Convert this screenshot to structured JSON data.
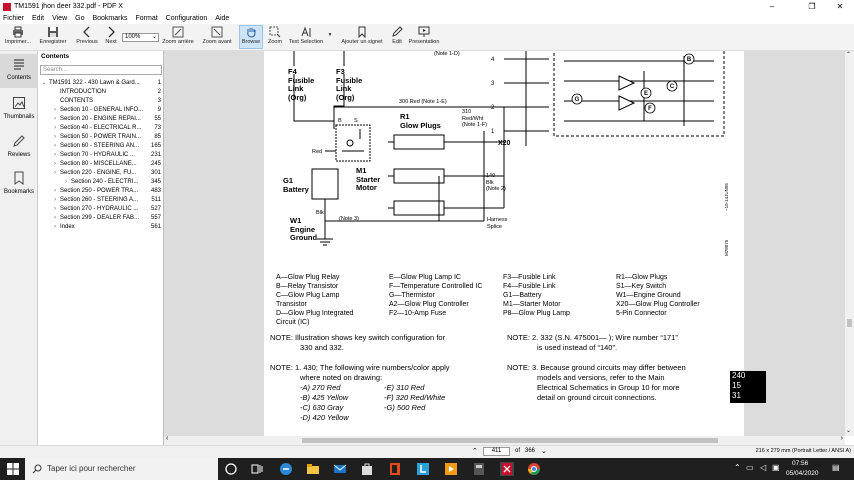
{
  "window": {
    "title": "TM1591 jhon deer 332.pdf - PDF X",
    "minimize": "–",
    "maximize": "❐",
    "close": "✕"
  },
  "menu": [
    "Fichier",
    "Edit",
    "View",
    "Go",
    "Bookmarks",
    "Format",
    "Configuration",
    "Aide"
  ],
  "toolbar": {
    "print": "Imprimer...",
    "save": "Enregistrer",
    "previous": "Previous",
    "next": "Next",
    "zoom_value": "100%",
    "zoom_back": "Zoom arrière",
    "zoom_forward": "Zoom avant",
    "browse": "Browse",
    "zoom": "Zoom",
    "text_selection": "Text Selection",
    "add_bookmark": "Ajouter un signet",
    "edit": "Edit",
    "presentation": "Presentation"
  },
  "left_rail": {
    "contents": "Contents",
    "thumbnails": "Thumbnails",
    "reviews": "Reviews",
    "bookmarks": "Bookmarks"
  },
  "nav_panel": {
    "title": "Contents",
    "search_placeholder": "Search...",
    "items": [
      {
        "label": "TM1591 322 - 430 Lawn & Gard...",
        "page": "1",
        "arrow": "⌄",
        "indent": 0
      },
      {
        "label": "INTRODUCTION",
        "page": "2",
        "arrow": "",
        "indent": 1
      },
      {
        "label": "CONTENTS",
        "page": "3",
        "arrow": "",
        "indent": 1
      },
      {
        "label": "Section 10 - GENERAL INFO...",
        "page": "9",
        "arrow": "›",
        "indent": 1
      },
      {
        "label": "Section 20 - ENGINE REPAI...",
        "page": "55",
        "arrow": "›",
        "indent": 1
      },
      {
        "label": "Section 40 - ELECTRICAL R...",
        "page": "73",
        "arrow": "›",
        "indent": 1
      },
      {
        "label": "Section 50 - POWER TRAIN...",
        "page": "85",
        "arrow": "›",
        "indent": 1
      },
      {
        "label": "Section 60 - STEERING AN...",
        "page": "165",
        "arrow": "›",
        "indent": 1
      },
      {
        "label": "Section 70 - HYDRAULIC ...",
        "page": "231",
        "arrow": "›",
        "indent": 1
      },
      {
        "label": "Section 80 - MISCELLANE...",
        "page": "245",
        "arrow": "›",
        "indent": 1
      },
      {
        "label": "Section 220 - ENGINE, FU...",
        "page": "301",
        "arrow": "›",
        "indent": 1
      },
      {
        "label": "Section 240 - ELECTRI...",
        "page": "345",
        "arrow": "›",
        "indent": 2
      },
      {
        "label": "Section 250 - POWER TRA...",
        "page": "483",
        "arrow": "›",
        "indent": 1
      },
      {
        "label": "Section 260 - STEERING A...",
        "page": "511",
        "arrow": "›",
        "indent": 1
      },
      {
        "label": "Section 270 - HYDRAULIC ...",
        "page": "527",
        "arrow": "›",
        "indent": 1
      },
      {
        "label": "Section 299 - DEALER FAB...",
        "page": "557",
        "arrow": "›",
        "indent": 1
      },
      {
        "label": "Index",
        "page": "561",
        "arrow": "›",
        "indent": 1
      }
    ]
  },
  "diagram": {
    "f4": [
      "F4",
      "Fusible",
      "Link",
      "(Org)"
    ],
    "f3": [
      "F3",
      "Fusible",
      "Link",
      "(Org)"
    ],
    "note1e": "300 Red (Note 1-E)",
    "note1d": "(Note 1-D)",
    "r1": [
      "R1",
      "Glow Plugs"
    ],
    "wire310": [
      "310",
      "Red/Wht",
      "(Note 1-F)"
    ],
    "red": "Red",
    "b": "B",
    "s": "S",
    "m1": [
      "M1",
      "Starter",
      "Motor"
    ],
    "g1": [
      "G1",
      "Battery"
    ],
    "blk": "Blk",
    "note3": "(Note 3)",
    "w1": [
      "W1",
      "Engine",
      "Ground"
    ],
    "wire140": [
      "140",
      "Blk",
      "(Note 2)"
    ],
    "harness": [
      "Harness",
      "Splice"
    ],
    "x20": "X20",
    "pins": [
      "4",
      "3",
      "2",
      "1"
    ],
    "circle_labels": [
      "B",
      "C",
      "E",
      "F",
      "G"
    ],
    "side_codes": [
      "~19-14JUN95",
      "M78075"
    ]
  },
  "legend": [
    [
      "A—Glow Plug Relay",
      "B—Relay Transistor",
      "C—Glow Plug Lamp",
      "   Transistor",
      "D—Glow Plug Integrated",
      "   Circuit (IC)"
    ],
    [
      "E—Glow Plug Lamp IC",
      "F—Temperature Controlled IC",
      "G—Thermistor",
      "A2—Glow Plug Controller",
      "F2—10-Amp Fuse"
    ],
    [
      "F3—Fusible Link",
      "F4—Fusible Link",
      "G1—Battery",
      "M1—Starter Motor",
      "P8—Glow Plug Lamp"
    ],
    [
      "R1—Glow Plugs",
      "S1—Key Switch",
      "W1—Engine Ground",
      "X20—Glow Plug Controller",
      "   5-Pin Connector"
    ]
  ],
  "notes": {
    "left1": [
      "NOTE: Illustration shows key switch configuration for",
      "330 and 332."
    ],
    "left2_head": "NOTE: 1. 430; The following wire numbers/color apply",
    "left2_sub": "where noted on drawing:",
    "left2_colA": [
      "-A) 270 Red",
      "-B) 425 Yellow",
      "-C) 630 Gray",
      "-D) 420 Yellow"
    ],
    "left2_colB": [
      "-E) 310 Red",
      "-F) 320 Red/White",
      "-G) 500 Red"
    ],
    "right1": [
      "NOTE: 2. 332 (S.N. 475001—     ); Wire number “171”",
      "is used instead of “140”."
    ],
    "right2": [
      "NOTE: 3. Because ground circuits may differ between",
      "models and versions, refer to the Main",
      "Electrical Schematics in Group 10 for more",
      "detail on ground circuit connections."
    ]
  },
  "side_tab": [
    "240",
    "15",
    "31"
  ],
  "status": {
    "current_page": "411",
    "of_label": "of",
    "total_pages": "366",
    "page_size": "216 x 279 mm (Portrait Letter / ANSI A)"
  },
  "taskbar": {
    "search_placeholder": "Taper ici pour rechercher",
    "time": "07:56",
    "date": "05/04/2020"
  }
}
